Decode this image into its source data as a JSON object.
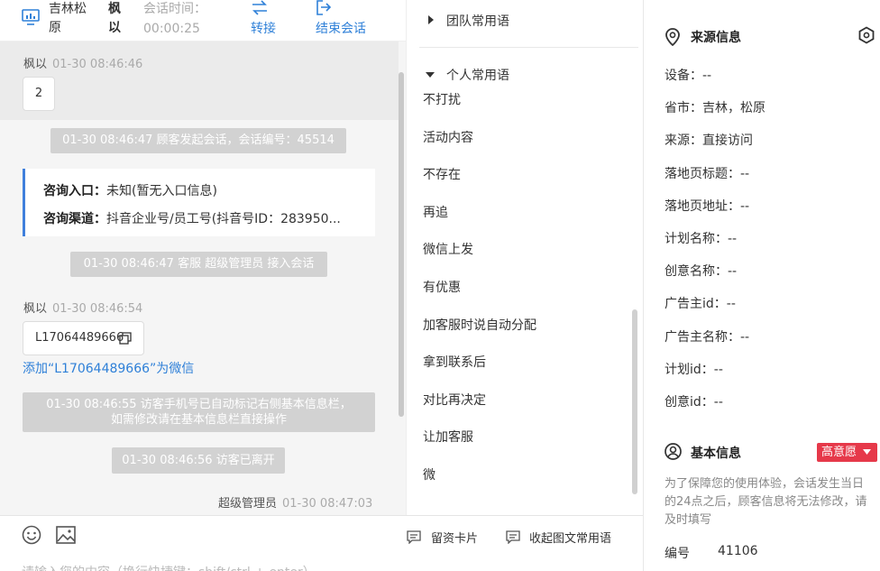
{
  "header": {
    "location": "吉林松原",
    "visitor_name": "枫以",
    "session_time_label": "会话时间：",
    "session_time": "00:00:25",
    "transfer_label": "转接",
    "end_label": "结束会话"
  },
  "messages": {
    "m1_sender": "枫以",
    "m1_time": "01-30 08:46:46",
    "m1_text": "2",
    "sys1": "01-30 08:46:47 顾客发起会话，会话编号：45514",
    "card_entry_label": "咨询入口：",
    "card_entry_value": "未知(暂无入口信息)",
    "card_channel_label": "咨询渠道：",
    "card_channel_value": "抖音企业号/员工号(抖音号ID：283950...",
    "sys2": "01-30 08:46:47 客服 超级管理员 接入会话",
    "m2_sender": "枫以",
    "m2_time": "01-30 08:46:54",
    "m2_text": "L17064489666",
    "add_wechat": "添加“L17064489666”为微信",
    "sys3_line1": "01-30 08:46:55 访客手机号已自动标记右侧基本信息栏，",
    "sys3_line2": "如需修改请在基本信息栏直接操作",
    "sys4": "01-30 08:46:56 访客已离开",
    "m3_sender": "超级管理员",
    "m3_time": "01-30 08:47:03"
  },
  "input": {
    "placeholder": "请输入您的内容（换行快捷键：shift/ctrl + enter）",
    "lead_card_label": "留资卡片",
    "collect_label": "收起图文常用语"
  },
  "phrases": {
    "team_title": "团队常用语",
    "personal_title": "个人常用语",
    "items": [
      "不打扰",
      "活动内容",
      "不存在",
      "再追",
      "微信上发",
      "有优惠",
      "加客服时说自动分配",
      "拿到联系后",
      "对比再决定",
      "让加客服",
      "微"
    ]
  },
  "source_info": {
    "title": "来源信息",
    "rows": [
      "设备：--",
      "省市：吉林，松原",
      "来源：直接访问",
      "落地页标题：--",
      "落地页地址：--",
      "计划名称：--",
      "创意名称：--",
      "广告主id：--",
      "广告主名称：--",
      "计划id：--",
      "创意id：--"
    ]
  },
  "basic_info": {
    "title": "基本信息",
    "intent_badge": "高意愿",
    "note": "为了保障您的使用体验，会话发生当日的24点之后，顾客信息将无法修改，请及时填写",
    "id_label": "编号",
    "id_value": "41106"
  },
  "colors": {
    "accent": "#2f80d8",
    "badge": "#e6394a",
    "card_border": "#3f7fdc"
  }
}
